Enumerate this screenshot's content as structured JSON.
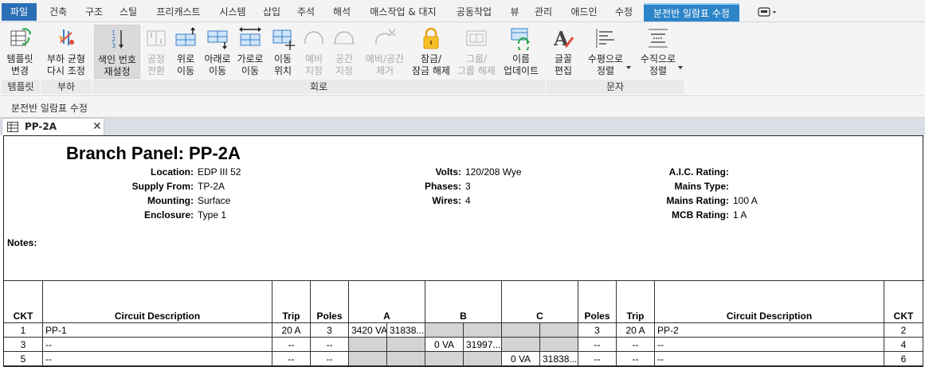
{
  "menu": {
    "tabs": [
      "파일",
      "건축",
      "구조",
      "스틸",
      "프리캐스트",
      "시스템",
      "삽입",
      "주석",
      "해석",
      "매스작업 & 대지",
      "공동작업",
      "뷰",
      "관리",
      "애드인",
      "수정"
    ],
    "context_tab": "분전반 일람표 수정"
  },
  "ribbon": {
    "buttons": [
      {
        "line1": "템플릿",
        "line2": "변경",
        "icon": "template-swap-icon"
      },
      {
        "line1": "부하 균형",
        "line2": "다시 조정",
        "icon": "load-balance-icon"
      },
      {
        "line1": "색인 번호",
        "line2": "재설정",
        "icon": "renumber-icon"
      },
      {
        "line1": "공정",
        "line2": "전환",
        "icon": "swap-phase-icon"
      },
      {
        "line1": "위로",
        "line2": "이동",
        "icon": "move-up-icon"
      },
      {
        "line1": "아래로",
        "line2": "이동",
        "icon": "move-down-icon"
      },
      {
        "line1": "가로로",
        "line2": "이동",
        "icon": "move-across-icon"
      },
      {
        "line1": "이동",
        "line2": "위치",
        "icon": "move-to-icon"
      },
      {
        "line1": "예비",
        "line2": "지정",
        "icon": "assign-spare-icon"
      },
      {
        "line1": "공간",
        "line2": "지정",
        "icon": "assign-space-icon"
      },
      {
        "line1": "예비/공간",
        "line2": "제거",
        "icon": "remove-spare-icon"
      },
      {
        "line1": "잠금/",
        "line2": "잠금 해제",
        "icon": "lock-icon"
      },
      {
        "line1": "그룹/",
        "line2": "그룹 해제",
        "icon": "group-icon"
      },
      {
        "line1": "이름",
        "line2": "업데이트",
        "icon": "update-names-icon"
      },
      {
        "line1": "글꼴",
        "line2": "편집",
        "icon": "font-icon"
      },
      {
        "line1": "수평으로",
        "line2": "정렬",
        "icon": "align-horizontal-icon"
      },
      {
        "line1": "수직으로",
        "line2": "정렬",
        "icon": "align-vertical-icon"
      }
    ],
    "groups": [
      "템플릿",
      "부하",
      "회로",
      "문자"
    ]
  },
  "context_bar": {
    "label": "분전반 일람표 수정"
  },
  "document_tab": {
    "title": "PP-2A"
  },
  "panel": {
    "title": "Branch Panel: PP-2A",
    "info": [
      {
        "label": "Location:",
        "value": "EDP III 52"
      },
      {
        "label": "Supply From:",
        "value": "TP-2A"
      },
      {
        "label": "Mounting:",
        "value": "Surface"
      },
      {
        "label": "Enclosure:",
        "value": "Type 1"
      },
      {
        "label": "Volts:",
        "value": "120/208 Wye"
      },
      {
        "label": "Phases:",
        "value": "3"
      },
      {
        "label": "Wires:",
        "value": "4"
      },
      {
        "label": "A.I.C. Rating:",
        "value": ""
      },
      {
        "label": "Mains Type:",
        "value": ""
      },
      {
        "label": "Mains Rating:",
        "value": "100 A"
      },
      {
        "label": "MCB Rating:",
        "value": "1 A"
      }
    ],
    "notes_label": "Notes:"
  },
  "schedule": {
    "headers": [
      "CKT",
      "Circuit Description",
      "Trip",
      "Poles",
      "A",
      "B",
      "C",
      "Poles",
      "Trip",
      "Circuit Description",
      "CKT"
    ],
    "rows": [
      {
        "ckt_l": "1",
        "desc_l": "PP-1",
        "trip_l": "20 A",
        "poles_l": "3",
        "a1": "3420 VA",
        "a2": "31838...",
        "b1": "",
        "b2": "",
        "c1": "",
        "c2": "",
        "poles_r": "3",
        "trip_r": "20 A",
        "desc_r": "PP-2",
        "ckt_r": "2"
      },
      {
        "ckt_l": "3",
        "desc_l": "--",
        "trip_l": "--",
        "poles_l": "--",
        "a1": "",
        "a2": "",
        "b1": "0 VA",
        "b2": "31997...",
        "c1": "",
        "c2": "",
        "poles_r": "--",
        "trip_r": "--",
        "desc_r": "--",
        "ckt_r": "4"
      },
      {
        "ckt_l": "5",
        "desc_l": "--",
        "trip_l": "--",
        "poles_l": "--",
        "a1": "",
        "a2": "",
        "b1": "",
        "b2": "",
        "c1": "0 VA",
        "c2": "31838...",
        "poles_r": "--",
        "trip_r": "--",
        "desc_r": "--",
        "ckt_r": "6"
      }
    ]
  }
}
